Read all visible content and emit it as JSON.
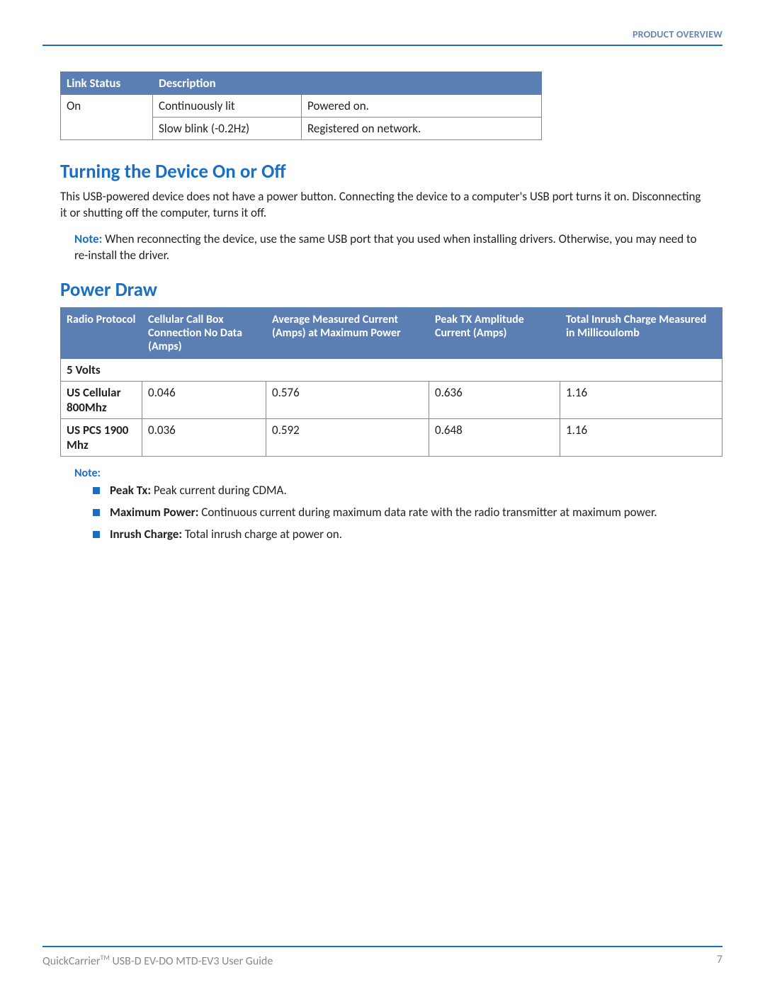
{
  "header": {
    "label": "PRODUCT OVERVIEW"
  },
  "linkTable": {
    "headers": [
      "Link Status",
      "Description",
      ""
    ],
    "rows": [
      {
        "c0": "On",
        "c1": "Continuously lit",
        "c2": "Powered on."
      },
      {
        "c0": "",
        "c1": "Slow blink (-0.2Hz)",
        "c2": "Registered on network."
      }
    ]
  },
  "section1": {
    "title": "Turning the Device On or Off",
    "body": "This USB-powered device does not have a power button. Connecting the device to a computers's USB port turns it on. Disconnecting it or shutting off the computer, turns it off.",
    "noteLabel": "Note:",
    "noteText": "When reconnecting the device, use the same USB port that you used when installing drivers. Otherwise, you may need to re-install the driver."
  },
  "section2": {
    "title": "Power Draw",
    "headers": [
      "Radio Protocol",
      "Cellular Call Box Connection No Data (Amps)",
      "Average Measured Current (Amps) at Maximum Power",
      "Peak TX Amplitude Current (Amps)",
      "Total Inrush Charge Measured in Millicoulomb"
    ],
    "sectionRow": "5 Volts",
    "rows": [
      {
        "c0": "US Cellular 800Mhz",
        "c1": "0.046",
        "c2": "0.576",
        "c3": "0.636",
        "c4": "1.16"
      },
      {
        "c0": "US PCS 1900 Mhz",
        "c1": "0.036",
        "c2": "0.592",
        "c3": "0.648",
        "c4": "1.16"
      }
    ]
  },
  "defs": {
    "noteLabel": "Note:",
    "items": [
      {
        "term": "Peak Tx:",
        "text": "Peak current during CDMA."
      },
      {
        "term": "Maximum Power:",
        "text": "Continuous current during maximum data rate with the radio transmitter at maximum power."
      },
      {
        "term": "Inrush Charge:",
        "text": "Total inrush charge at power on."
      }
    ]
  },
  "footer": {
    "titlePrefix": "QuickCarrier",
    "tm": "TM",
    "titleSuffix": " USB-D EV-DO MTD-EV3 User Guide",
    "page": "7"
  }
}
